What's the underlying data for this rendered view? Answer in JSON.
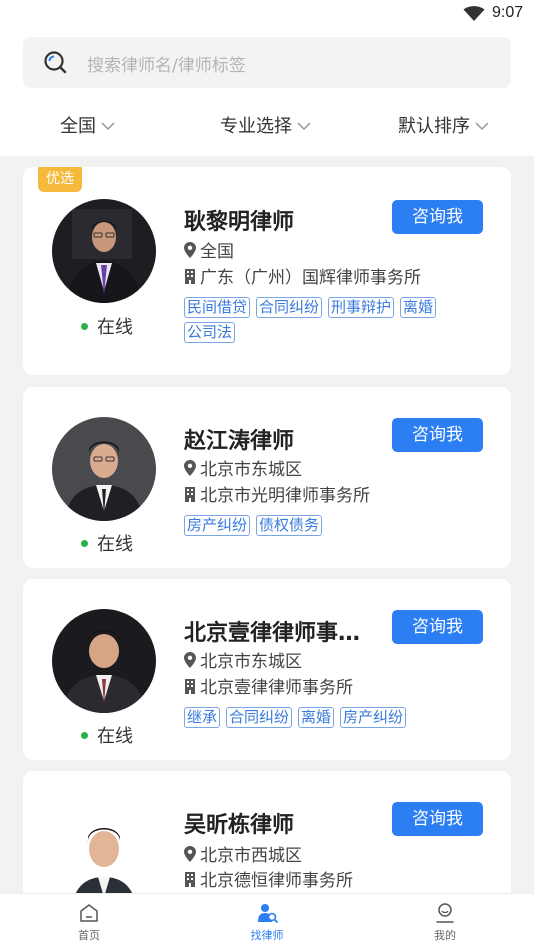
{
  "status_bar": {
    "time": "9:07",
    "icons": [
      "wifi-icon"
    ]
  },
  "search": {
    "placeholder": "搜索律师名/律师标签",
    "icon": "search-icon"
  },
  "filters": [
    {
      "label": "全国",
      "icon": "chevron-down-icon"
    },
    {
      "label": "专业选择",
      "icon": "chevron-down-icon"
    },
    {
      "label": "默认排序",
      "icon": "chevron-down-icon"
    }
  ],
  "lawyers": [
    {
      "badge": "优选",
      "name": "耿黎明律师",
      "region": "全国",
      "firm": "广东（广州）国辉律师事务所",
      "tags": [
        "民间借贷",
        "合同纠纷",
        "刑事辩护",
        "离婚",
        "公司法"
      ],
      "status": "在线",
      "button": "咨询我"
    },
    {
      "name": "赵江涛律师",
      "region": "北京市东城区",
      "firm": "北京市光明律师事务所",
      "tags": [
        "房产纠纷",
        "债权债务"
      ],
      "status": "在线",
      "button": "咨询我"
    },
    {
      "name": "北京壹律律师事…",
      "region": "北京市东城区",
      "firm": "北京壹律律师事务所",
      "tags": [
        "继承",
        "合同纠纷",
        "离婚",
        "房产纠纷"
      ],
      "status": "在线",
      "button": "咨询我"
    },
    {
      "name": "吴昕栋律师",
      "region": "北京市西城区",
      "firm": "北京德恒律师事务所",
      "button": "咨询我"
    }
  ],
  "tabbar": [
    {
      "label": "首页",
      "icon": "home-icon"
    },
    {
      "label": "找律师",
      "icon": "find-lawyer-icon",
      "active": true
    },
    {
      "label": "我的",
      "icon": "profile-icon"
    }
  ],
  "colors": {
    "accent": "#2c7ef3",
    "badge": "#f5b93b",
    "online": "#2ab14a"
  }
}
